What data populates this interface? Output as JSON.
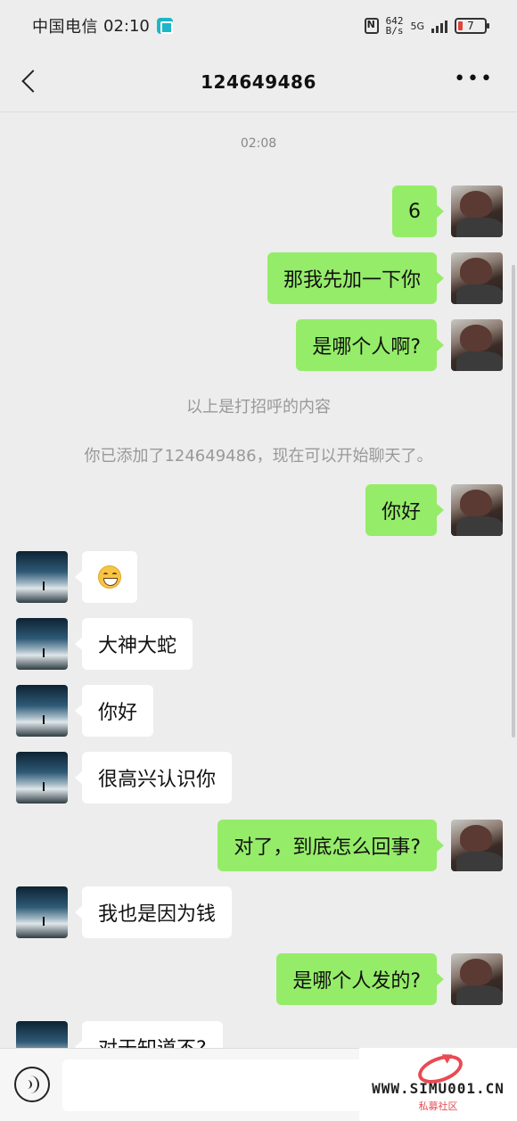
{
  "status_bar": {
    "carrier": "中国电信",
    "time": "02:10",
    "net_speed_value": "642",
    "net_speed_unit": "B/s",
    "network_type": "5G",
    "battery_level": "7"
  },
  "nav": {
    "title": "124649486"
  },
  "chat": {
    "timestamp": "02:08",
    "system_greeting": "以上是打招呼的内容",
    "system_added": "你已添加了124649486，现在可以开始聊天了。",
    "messages": [
      {
        "from": "me",
        "text": "6"
      },
      {
        "from": "me",
        "text": "那我先加一下你"
      },
      {
        "from": "me",
        "text": "是哪个人啊?"
      },
      {
        "from": "me",
        "text": "你好"
      },
      {
        "from": "friend",
        "text": "😁"
      },
      {
        "from": "friend",
        "text": "大神大蛇"
      },
      {
        "from": "friend",
        "text": "你好"
      },
      {
        "from": "friend",
        "text": "很高兴认识你"
      },
      {
        "from": "me",
        "text": "对了，到底怎么回事?"
      },
      {
        "from": "friend",
        "text": "我也是因为钱"
      },
      {
        "from": "me",
        "text": "是哪个人发的?"
      },
      {
        "from": "friend",
        "text": "对于知道不?"
      }
    ]
  },
  "watermark": {
    "url": "WWW.SIMU001.CN",
    "subtitle": "私募社区"
  }
}
